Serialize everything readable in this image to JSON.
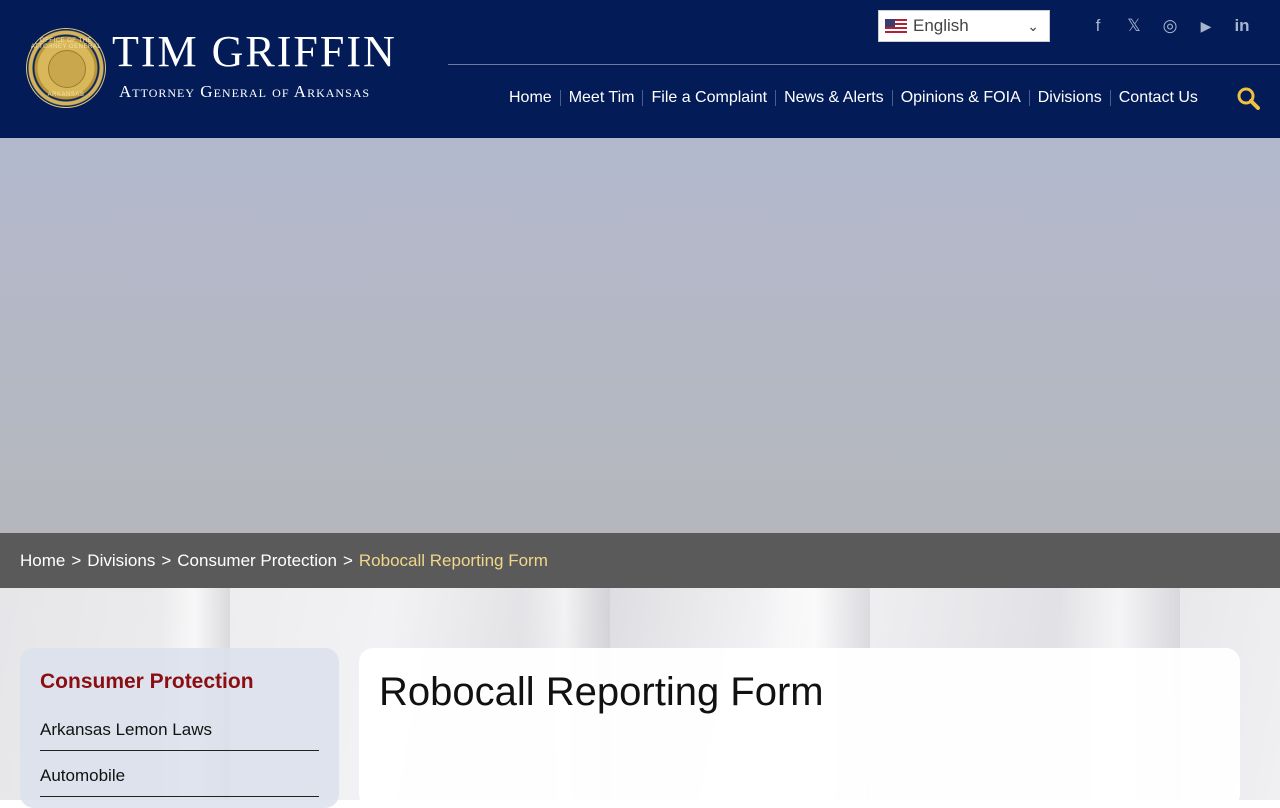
{
  "header": {
    "brand_title": "TIM GRIFFIN",
    "brand_subtitle": "Attorney General of Arkansas",
    "seal_text_top": "OFFICE OF THE ATTORNEY GENERAL",
    "seal_text_bottom": "ARKANSAS",
    "background_color": "#031c57"
  },
  "language": {
    "selected": "English"
  },
  "social": [
    {
      "name": "facebook-icon",
      "glyph": "f"
    },
    {
      "name": "x-twitter-icon",
      "glyph": "𝕏"
    },
    {
      "name": "instagram-icon",
      "glyph": "◎"
    },
    {
      "name": "youtube-icon",
      "glyph": "▶"
    },
    {
      "name": "linkedin-icon",
      "glyph": "in"
    }
  ],
  "nav": {
    "items": [
      "Home",
      "Meet Tim",
      "File a Complaint",
      "News & Alerts",
      "Opinions & FOIA",
      "Divisions",
      "Contact Us"
    ]
  },
  "breadcrumb": {
    "items": [
      "Home",
      "Divisions",
      "Consumer Protection"
    ],
    "separator": ">",
    "current": "Robocall Reporting Form"
  },
  "sidebar": {
    "title": "Consumer Protection",
    "items": [
      "Arkansas Lemon Laws",
      "Automobile"
    ]
  },
  "main": {
    "title": "Robocall Reporting Form"
  },
  "colors": {
    "accent_gold": "#f0c040",
    "sidebar_title": "#8b0f12"
  }
}
